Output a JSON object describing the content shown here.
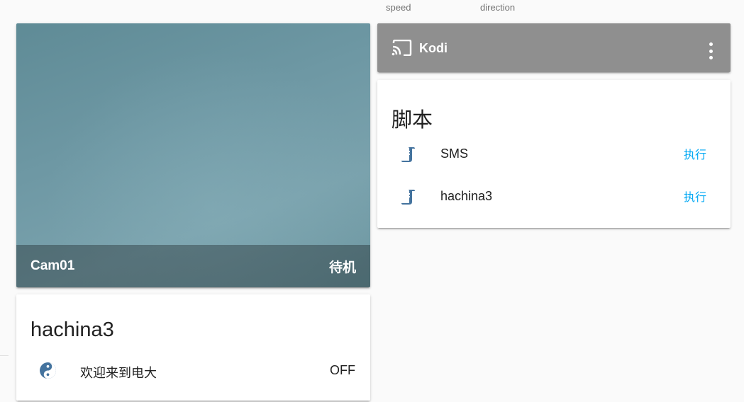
{
  "top_labels": {
    "speed": "speed",
    "direction": "direction"
  },
  "camera": {
    "name": "Cam01",
    "state": "待机"
  },
  "media_player": {
    "title": "Kodi",
    "icon": "cast-icon",
    "menu_icon": "dots-vertical-icon",
    "color": "#8f8f8f"
  },
  "scripts": {
    "title": "脚本",
    "items": [
      {
        "name": "SMS",
        "action": "执行",
        "icon": "script-icon"
      },
      {
        "name": "hachina3",
        "action": "执行",
        "icon": "script-icon"
      }
    ]
  },
  "group": {
    "title": "hachina3",
    "items": [
      {
        "name": "欢迎来到电大",
        "state": "OFF",
        "icon": "yin-yang-icon"
      }
    ]
  },
  "colors": {
    "accent": "#03a9f4",
    "icon": "#44739e",
    "background": "#fafafa"
  }
}
